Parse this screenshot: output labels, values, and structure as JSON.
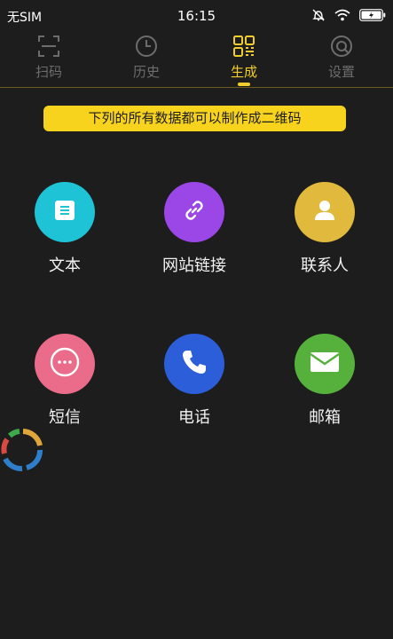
{
  "status_bar": {
    "carrier": "无SIM",
    "time": "16:15"
  },
  "tabs": [
    {
      "label": "扫码",
      "icon": "scan-icon"
    },
    {
      "label": "历史",
      "icon": "clock-icon"
    },
    {
      "label": "生成",
      "icon": "qr-grid-icon",
      "active": true
    },
    {
      "label": "设置",
      "icon": "settings-icon"
    }
  ],
  "banner": "下列的所有数据都可以制作成二维码",
  "items": [
    {
      "label": "文本",
      "icon": "document-icon",
      "color": "#1fc3d6"
    },
    {
      "label": "网站链接",
      "icon": "link-icon",
      "color": "#9b46e6"
    },
    {
      "label": "联系人",
      "icon": "person-icon",
      "color": "#e1b93c"
    },
    {
      "label": "短信",
      "icon": "chat-bubble-icon",
      "color": "#ea6c8a"
    },
    {
      "label": "电话",
      "icon": "phone-icon",
      "color": "#2d5ed9"
    },
    {
      "label": "邮箱",
      "icon": "mail-icon",
      "color": "#55b13c"
    }
  ],
  "colors": {
    "background": "#1d1d1d",
    "accent": "#f7d31e",
    "inactive": "#6d6d6d"
  }
}
